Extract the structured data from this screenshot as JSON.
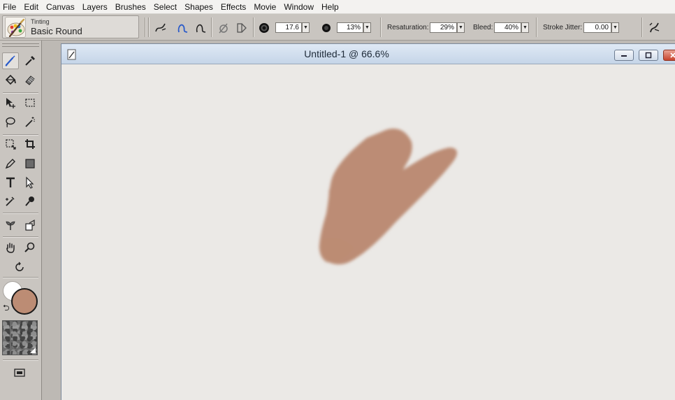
{
  "menubar": {
    "items": [
      "File",
      "Edit",
      "Canvas",
      "Layers",
      "Brushes",
      "Select",
      "Shapes",
      "Effects",
      "Movie",
      "Window",
      "Help"
    ]
  },
  "brush_selector": {
    "category": "Tinting",
    "variant": "Basic Round"
  },
  "property_bar": {
    "size_value": "17.6",
    "opacity_value": "13%",
    "resaturation_label": "Resaturation:",
    "resaturation_value": "29%",
    "bleed_label": "Bleed:",
    "bleed_value": "40%",
    "stroke_jitter_label": "Stroke Jitter:",
    "stroke_jitter_value": "0.00"
  },
  "toolbox": {
    "foreground_color": "#bc8c74",
    "background_color": "#ffffff",
    "tools": [
      "brush-tool-icon",
      "dropper-tool-icon",
      "paint-bucket-icon",
      "eraser-icon",
      "layer-adjuster-icon",
      "rectangular-selection-icon",
      "lasso-icon",
      "magic-wand-icon",
      "transform-icon",
      "crop-icon",
      "pen-icon",
      "rectangle-shape-icon",
      "text-tool-icon",
      "shape-selection-icon",
      "cloner-icon",
      "rubber-stamp-icon",
      "dodge-icon",
      "burn-icon",
      "grabber-hand-icon",
      "magnifier-icon",
      "rotate-page-icon"
    ]
  },
  "document": {
    "title": "Untitled-1 @ 66.6%",
    "stroke_color": "#bc8c74",
    "canvas_color": "#ebe9e6"
  }
}
